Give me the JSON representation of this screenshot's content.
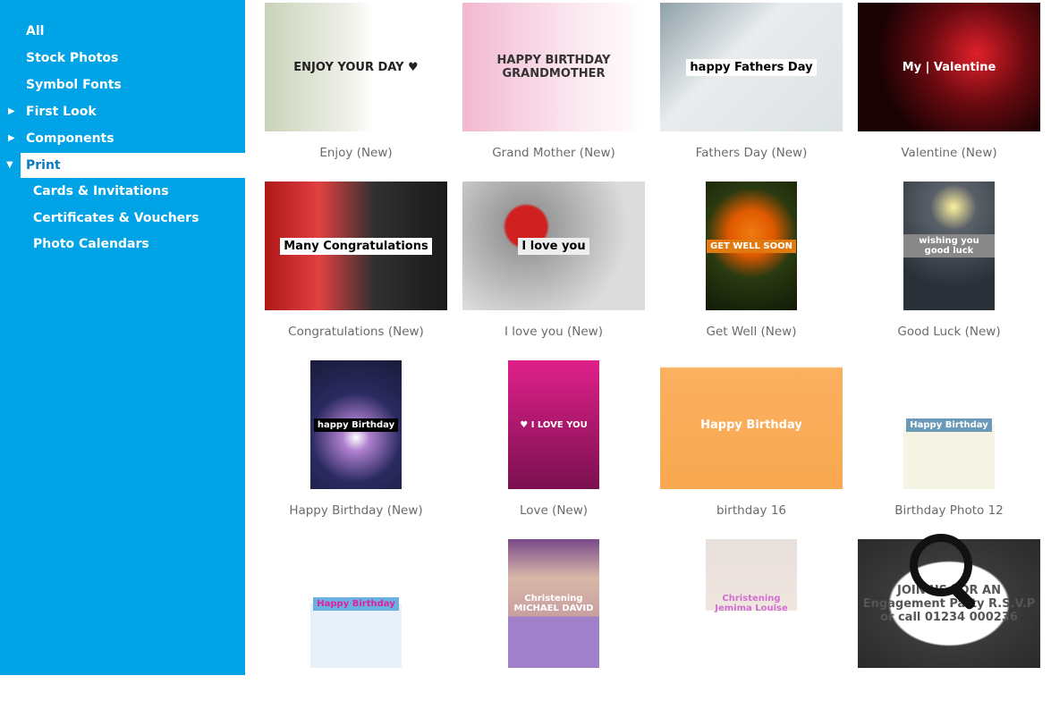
{
  "sidebar": {
    "items": [
      {
        "label": "All",
        "level": 0,
        "caret": ""
      },
      {
        "label": "Stock Photos",
        "level": 0,
        "caret": ""
      },
      {
        "label": "Symbol Fonts",
        "level": 0,
        "caret": ""
      },
      {
        "label": "First Look",
        "level": 0,
        "caret": "▶"
      },
      {
        "label": "Components",
        "level": 0,
        "caret": "▶"
      },
      {
        "label": "Print",
        "level": 0,
        "caret": "▼",
        "active": true
      },
      {
        "label": "Cards & Invitations",
        "level": 1,
        "caret": ""
      },
      {
        "label": "Certificates & Vouchers",
        "level": 1,
        "caret": ""
      },
      {
        "label": "Photo Calendars",
        "level": 1,
        "caret": ""
      }
    ]
  },
  "templates": [
    {
      "caption": "Enjoy (New)",
      "shape": "land",
      "bg": "linear-gradient(90deg,#c9d3b8 0%,#eef0e8 45%,#ffffff 60%)",
      "text": "ENJOY YOUR DAY ♥",
      "fg": "#222",
      "ovbg": "transparent"
    },
    {
      "caption": "Grand Mother (New)",
      "shape": "land",
      "bg": "linear-gradient(90deg,#f2b8d0,#fbe6ef 60%,#fff)",
      "text": "HAPPY BIRTHDAY GRANDMOTHER",
      "fg": "#333",
      "ovbg": "transparent"
    },
    {
      "caption": "Fathers Day (New)",
      "shape": "land",
      "bg": "linear-gradient(135deg,#8fa0a8,#e8ecee 40%,#dde2e4)",
      "text": "happy Fathers Day",
      "fg": "#000",
      "ovbg": "#fff"
    },
    {
      "caption": "Valentine (New)",
      "shape": "land",
      "bg": "radial-gradient(circle at 65% 40%,#e0202a 0,#6a0a10 35%,#1a0204 70%)",
      "text": "My | Valentine",
      "fg": "#fff",
      "ovbg": "transparent"
    },
    {
      "caption": "Congratulations (New)",
      "shape": "land",
      "bg": "linear-gradient(90deg,#b01818,#e04040 30%,#303030 60%,#1a1a1a)",
      "text": "Many Congratulations",
      "fg": "#000",
      "ovbg": "#fff"
    },
    {
      "caption": "I love you (New)",
      "shape": "land",
      "bg": "radial-gradient(circle at 35% 35%,#d02020 0,#d02020 14%,#9a9a9a 16%,#dcdcdc 70%)",
      "text": "I love you",
      "fg": "#000",
      "ovbg": "#eee"
    },
    {
      "caption": "Get Well (New)",
      "shape": "port",
      "bg": "radial-gradient(circle at 50% 40%,#f07a10 0,#e05a00 25%,#2a3a10 50%,#101a08)",
      "text": "GET WELL SOON",
      "fg": "#fff",
      "ovbg": "#e07a10"
    },
    {
      "caption": "Good Luck (New)",
      "shape": "port",
      "bg": "radial-gradient(circle at 55% 20%,#fff2a0 0,#5a6068 20%,#2a3038 70%)",
      "text": "wishing you good luck",
      "fg": "#fff",
      "ovbg": "#888"
    },
    {
      "caption": "Happy Birthday (New)",
      "shape": "port",
      "bg": "radial-gradient(circle at 50% 60%,#fff 0,#b080d0 15%,#2a2a60 50%,#1a1a3a)",
      "text": "happy Birthday",
      "fg": "#fff",
      "ovbg": "#000"
    },
    {
      "caption": "Love (New)",
      "shape": "port",
      "bg": "linear-gradient(180deg,#e0208a,#7a1050)",
      "text": "♥ I LOVE YOU",
      "fg": "#fff",
      "ovbg": "transparent"
    },
    {
      "caption": "birthday 16",
      "shape": "land",
      "bg": "linear-gradient(180deg,#ffffff 0,#ffffff 5%,#fbb060 6%,#f8a850 100%)",
      "text": "Happy Birthday",
      "fg": "#fff",
      "ovbg": "transparent"
    },
    {
      "caption": "Birthday Photo 12",
      "shape": "port",
      "bg": "linear-gradient(180deg,#fff 0,#fff 50%,#f6f4e4 50%,#f6f4e4 100%)",
      "text": "Happy Birthday",
      "fg": "#fff",
      "ovbg": "#6a9ab8"
    },
    {
      "caption": "",
      "shape": "port",
      "bg": "linear-gradient(180deg,#fff 0,#fff 50%,#e8f0fa 50%)",
      "text": "Happy Birthday",
      "fg": "#e020a0",
      "ovbg": "#6ab0e0"
    },
    {
      "caption": "",
      "shape": "port",
      "bg": "linear-gradient(180deg,#7a4a8a 0,#d8b8a8 30%,#c8a0a0 60%,#a080c8 60%)",
      "text": "Christening MICHAEL DAVID",
      "fg": "#fff",
      "ovbg": "transparent"
    },
    {
      "caption": "",
      "shape": "port",
      "bg": "linear-gradient(180deg,#e8e0dc 0,#f0e6e0 55%,#fff 56%)",
      "text": "Christening Jemima Louise",
      "fg": "#d070d0",
      "ovbg": "transparent"
    },
    {
      "caption": "",
      "shape": "land",
      "bg": "radial-gradient(#fff 0,#fff 45%,#3a3a3a 47%,#2a2a2a)",
      "text": "JOIN US FOR AN Engagement Party R.S.V.P or call 01234 000236",
      "fg": "#555",
      "ovbg": "transparent"
    }
  ],
  "icons": {
    "cursor": "search-magnifier-icon"
  },
  "colors": {
    "sidebar": "#00a3e6",
    "active_text": "#0a7cc0"
  }
}
